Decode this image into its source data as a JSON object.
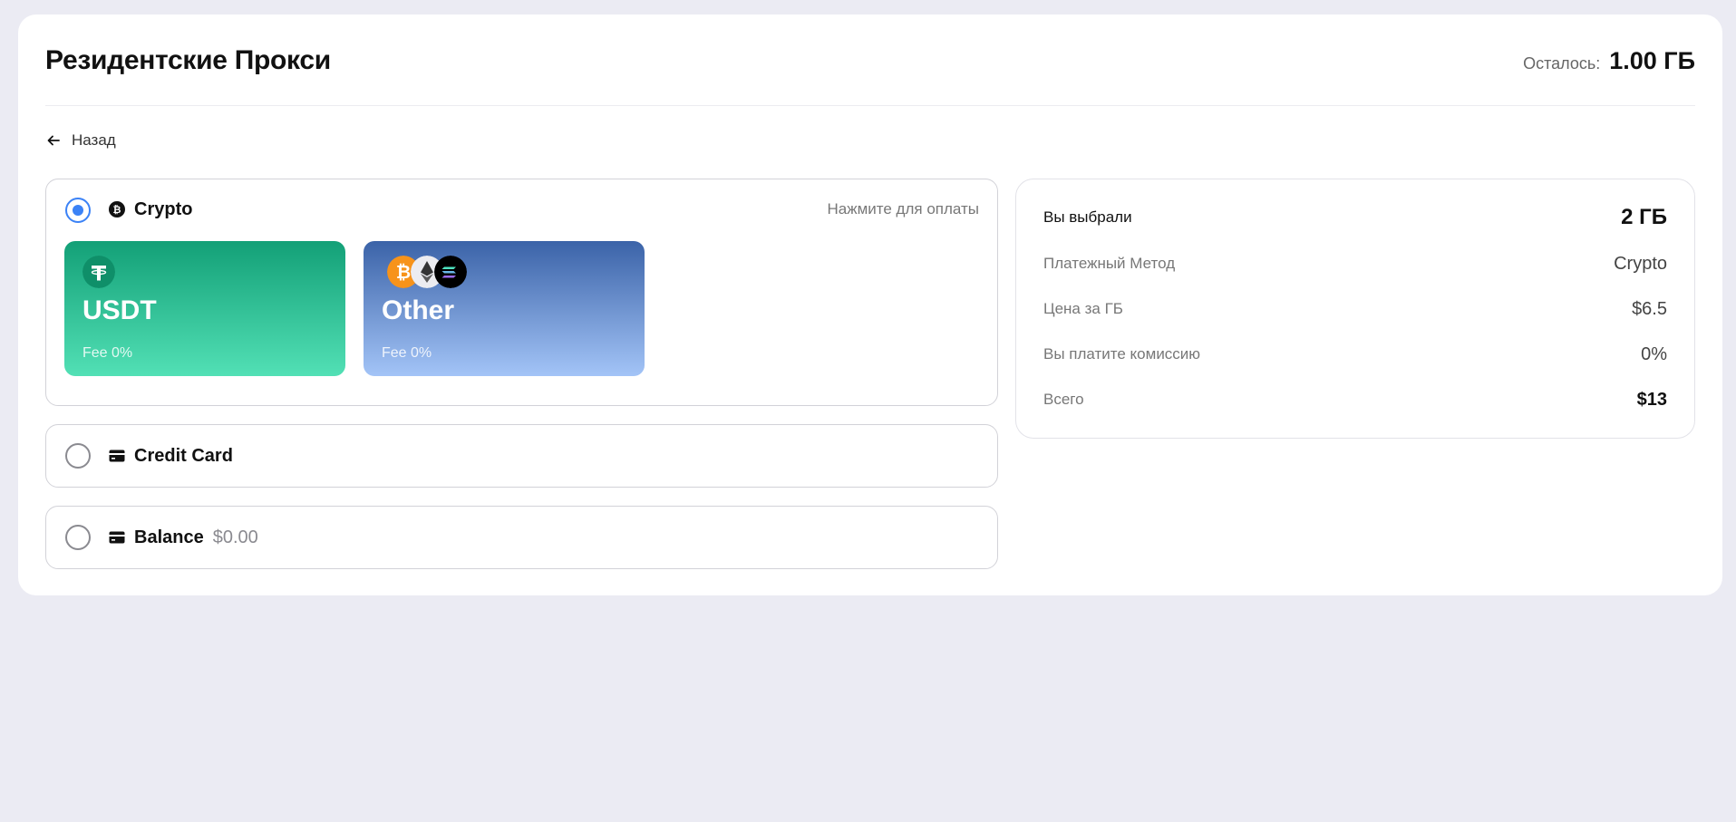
{
  "header": {
    "title": "Резидентские Прокси",
    "remaining_label": "Осталось:",
    "remaining_value": "1.00 ГБ"
  },
  "back": {
    "label": "Назад",
    "icon": "arrow-left-icon"
  },
  "payment_methods": {
    "crypto": {
      "label": "Crypto",
      "icon": "bitcoin-icon",
      "selected": true,
      "hint": "Нажмите для оплаты",
      "options": [
        {
          "name": "USDT",
          "fee": "Fee 0%",
          "icons": [
            "tether-icon"
          ]
        },
        {
          "name": "Other",
          "fee": "Fee 0%",
          "icons": [
            "bitcoin-icon",
            "ethereum-icon",
            "solana-icon"
          ]
        }
      ]
    },
    "credit_card": {
      "label": "Credit Card",
      "icon": "credit-card-icon",
      "selected": false
    },
    "balance": {
      "label": "Balance",
      "amount": "$0.00",
      "icon": "wallet-icon",
      "selected": false
    }
  },
  "summary": {
    "selected_label": "Вы выбрали",
    "selected_value": "2 ГБ",
    "method_label": "Платежный Метод",
    "method_value": "Crypto",
    "price_label": "Цена за ГБ",
    "price_value": "$6.5",
    "fee_label": "Вы платите комиссию",
    "fee_value": "0%",
    "total_label": "Всего",
    "total_value": "$13"
  },
  "colors": {
    "accent": "#3b82f6",
    "usdt_tile": "#13a077",
    "other_tile": "#3b63a8",
    "background": "#ebebf3"
  }
}
